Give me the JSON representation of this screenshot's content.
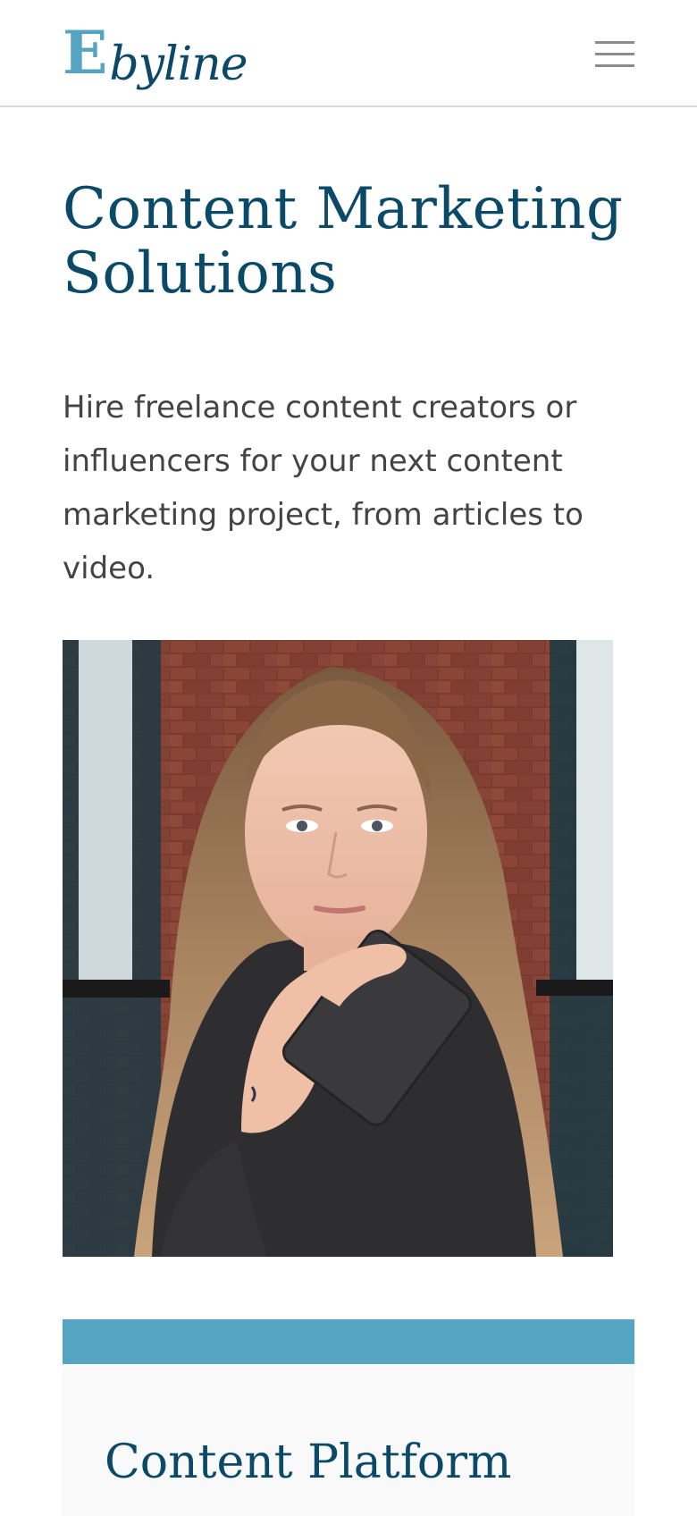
{
  "header": {
    "logo_mark": "E",
    "logo_word": "byline",
    "menu_icon": "hamburger-menu-icon"
  },
  "hero": {
    "title": "Content Marketing Solutions",
    "description": "Hire freelance content creators or influencers for your next content marketing project, from articles to video.",
    "image_subject": "photo-woman-holding-notebook"
  },
  "section": {
    "card_title": "Content Platform"
  },
  "colors": {
    "brand_dark": "#0a4a68",
    "brand_accent": "#55a4c2",
    "body_text": "#444444"
  }
}
